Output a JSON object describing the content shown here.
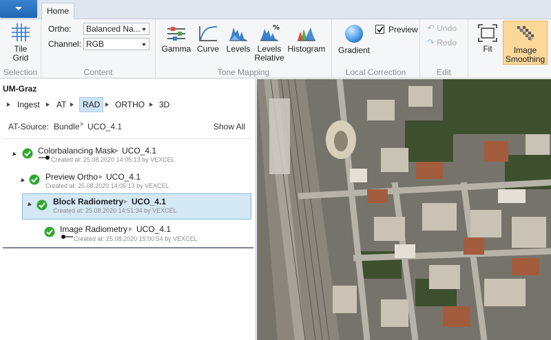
{
  "tabs": {
    "home": "Home"
  },
  "ribbon": {
    "selection": {
      "title": "Selection",
      "tile_grid_label_1": "Tile",
      "tile_grid_label_2": "Grid"
    },
    "content": {
      "title": "Content",
      "ortho_label": "Ortho:",
      "ortho_value": "Balanced Na...",
      "channel_label": "Channel:",
      "channel_value": "RGB"
    },
    "tone_mapping": {
      "title": "Tone Mapping",
      "gamma": "Gamma",
      "curve": "Curve",
      "levels": "Levels",
      "levels_relative_1": "Levels",
      "levels_relative_2": "Relative",
      "histogram": "Histogram"
    },
    "local_correction": {
      "title": "Local Correction",
      "gradient": "Gradient",
      "preview": "Preview",
      "preview_checked": true
    },
    "edit": {
      "title": "Edit",
      "undo": "Undo",
      "redo": "Redo"
    },
    "view": {
      "fit": "Fit",
      "image_smoothing_1": "Image",
      "image_smoothing_2": "Smoothing"
    }
  },
  "panel": {
    "project": "UM-Graz",
    "breadcrumbs": [
      "Ingest",
      "AT",
      "RAD",
      "ORTHO",
      "3D"
    ],
    "active_crumb": "RAD",
    "at_source_label": "AT-Source:",
    "at_source_value": "Bundle",
    "at_source_id": "UCO_4.1",
    "show_all": "Show All",
    "tree": [
      {
        "title": "Colorbalancing Mask",
        "version": "UCO_4.1",
        "created": "Created at: 25.08.2020 14:05:13 by VEXCEL"
      },
      {
        "title": "Preview Ortho",
        "version": "UCO_4.1",
        "created": "Created at: 25.08.2020 14:05:13 by VEXCEL"
      },
      {
        "title": "Block Radiometry",
        "version": "UCO_4.1",
        "created": "Created at: 25.08.2020 14:51:34 by VEXCEL"
      },
      {
        "title": "Image Radiometry",
        "version": "UCO_4.1",
        "created": "Created at: 25.08.2020 15:00:54 by VEXCEL"
      }
    ]
  },
  "colors": {
    "accent": "#1f67b4",
    "selection": "#d5e8f6",
    "active_tool": "#fcd79a",
    "check_green": "#2fa82f"
  }
}
